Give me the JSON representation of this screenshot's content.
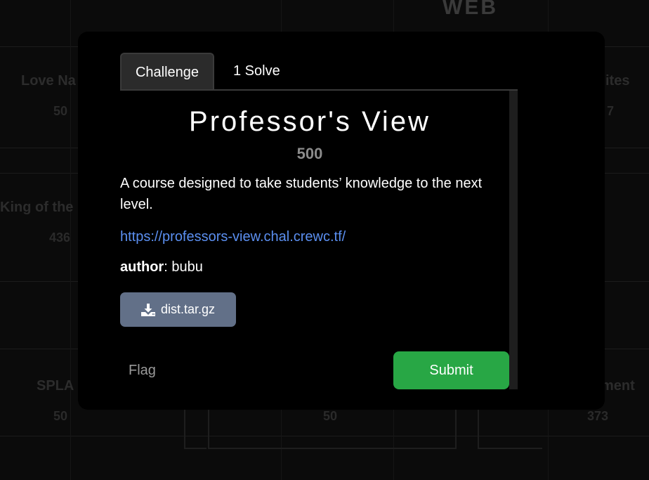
{
  "background": {
    "category_title": "WEB",
    "cards": [
      {
        "title": "Love Na",
        "points": "50"
      },
      {
        "title": "ites",
        "points": "7"
      },
      {
        "title": "King of the",
        "points": "436"
      },
      {
        "title": "SPLA",
        "points": "50"
      },
      {
        "title": "",
        "points": "50"
      },
      {
        "title": "ment",
        "points": "373"
      }
    ]
  },
  "modal": {
    "tabs": [
      {
        "label": "Challenge"
      },
      {
        "label": "1 Solve"
      }
    ],
    "challenge": {
      "name": "Professor's View",
      "value": "500",
      "description": "A course designed to take students’ knowledge to the next level.",
      "link": "https://professors-view.chal.crewc.tf/",
      "author_label": "author",
      "author_sep": ": ",
      "author_value": "bubu",
      "file_name": "dist.tar.gz",
      "file_icon": "download-icon"
    },
    "flag": {
      "placeholder": "Flag",
      "value": ""
    },
    "submit_label": "Submit"
  },
  "colors": {
    "submit": "#28a745",
    "download_button": "#627088",
    "link": "#5b8ff0",
    "points_text": "#8b8b8b"
  }
}
